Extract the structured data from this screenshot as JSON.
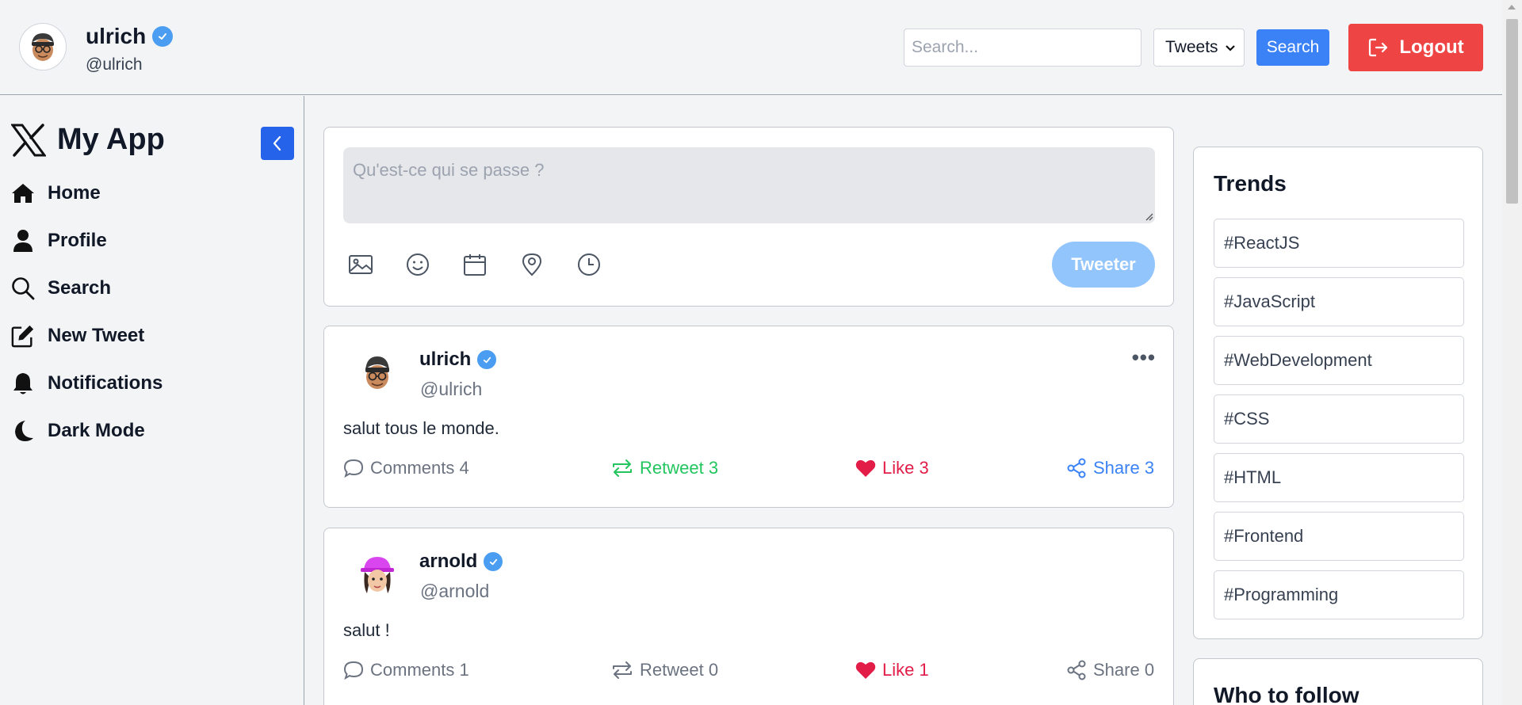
{
  "header": {
    "user_name": "ulrich",
    "user_handle": "@ulrich",
    "search_placeholder": "Search...",
    "search_type_selected": "Tweets",
    "search_button": "Search",
    "logout_button": "Logout"
  },
  "sidebar": {
    "brand": "My App",
    "items": [
      {
        "label": "Home",
        "icon": "home-icon"
      },
      {
        "label": "Profile",
        "icon": "user-icon"
      },
      {
        "label": "Search",
        "icon": "search-icon"
      },
      {
        "label": "New Tweet",
        "icon": "edit-icon"
      },
      {
        "label": "Notifications",
        "icon": "bell-icon"
      },
      {
        "label": "Dark Mode",
        "icon": "moon-icon"
      }
    ]
  },
  "composer": {
    "placeholder": "Qu'est-ce qui se passe ?",
    "tools": [
      "image-icon",
      "emoji-icon",
      "calendar-icon",
      "location-icon",
      "clock-icon"
    ],
    "submit_label": "Tweeter"
  },
  "tweets": [
    {
      "name": "ulrich",
      "handle": "@ulrich",
      "text": "salut tous le monde.",
      "comments": "Comments 4",
      "retweets": "Retweet 3",
      "likes": "Like 3",
      "shares": "Share 3",
      "more": "•••"
    },
    {
      "name": "arnold",
      "handle": "@arnold",
      "text": "salut !",
      "comments": "Comments 1",
      "retweets": "Retweet 0",
      "likes": "Like 1",
      "shares": "Share 0"
    }
  ],
  "trends": {
    "title": "Trends",
    "items": [
      "#ReactJS",
      "#JavaScript",
      "#WebDevelopment",
      "#CSS",
      "#HTML",
      "#Frontend",
      "#Programming"
    ]
  },
  "who_to_follow": {
    "title": "Who to follow"
  },
  "colors": {
    "primary": "#3b82f6",
    "danger": "#ef4444",
    "retweet_active": "#22c55e",
    "like": "#e11d48",
    "verified": "#4a9df0"
  }
}
